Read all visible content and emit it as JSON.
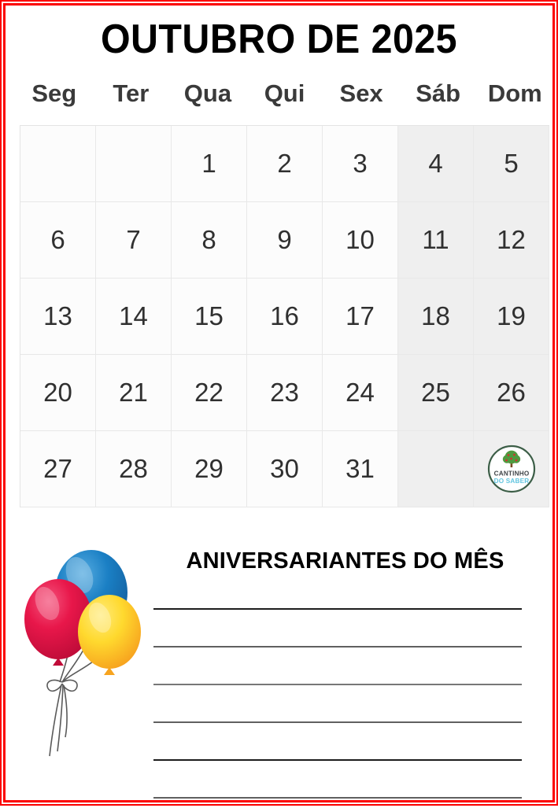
{
  "document": {
    "type": "printable-monthly-calendar",
    "language": "pt-BR",
    "frame_color": "#fb0000",
    "background_color": "#ffffff"
  },
  "header": {
    "month_title": "OUTUBRO DE 2025",
    "month_name": "OUTUBRO",
    "year": "2025"
  },
  "calendar": {
    "weekday_headers": [
      "Seg",
      "Ter",
      "Qua",
      "Qui",
      "Sex",
      "Sáb",
      "Dom"
    ],
    "weekend_columns": [
      5,
      6
    ],
    "weekend_background": "#efefef",
    "weekday_background": "#fcfcfc",
    "grid_line_color": "#e8e8e8",
    "day_text_color": "#303030",
    "weeks": [
      [
        "",
        "",
        "1",
        "2",
        "3",
        "4",
        "5"
      ],
      [
        "6",
        "7",
        "8",
        "9",
        "10",
        "11",
        "12"
      ],
      [
        "13",
        "14",
        "15",
        "16",
        "17",
        "18",
        "19"
      ],
      [
        "20",
        "21",
        "22",
        "23",
        "24",
        "25",
        "26"
      ],
      [
        "27",
        "28",
        "29",
        "30",
        "31",
        "",
        ""
      ]
    ],
    "logo_cell": {
      "week": 4,
      "column": 6
    }
  },
  "logo": {
    "name": "cantinho-do-saber-logo",
    "line1": "CANTINHO",
    "line2": "DO SABER",
    "ring_color": "#3c5e47",
    "line1_color": "#3f4448",
    "line2_color": "#63c6e0",
    "tree_foliage_color": "#4f9a3f",
    "tree_fruit_color": "#d1342f",
    "tree_trunk_color": "#7b4a24"
  },
  "birthdays": {
    "title": "ANIVERSARIANTES DO MÊS",
    "line_count": 6,
    "illustration": "balloons-icon",
    "balloon_colors": {
      "blue": "#1a7fc4",
      "blue_dark": "#15609e",
      "pink": "#e8174a",
      "pink_dark": "#c10d3a",
      "yellow": "#ffd92e",
      "yellow_dark": "#f9a826",
      "string": "#5a5a5a"
    },
    "lines": [
      {
        "tone": "dark"
      },
      {
        "tone": "mid"
      },
      {
        "tone": "soft"
      },
      {
        "tone": "mid"
      },
      {
        "tone": "dark"
      },
      {
        "tone": "mid"
      }
    ]
  }
}
